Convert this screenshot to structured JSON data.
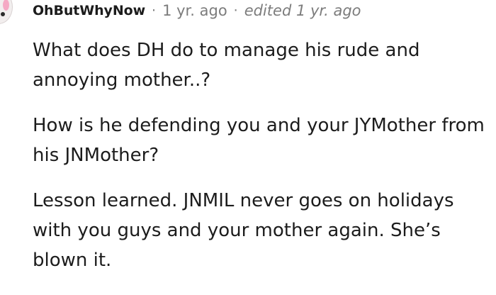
{
  "comment": {
    "author": "OhButWhyNow",
    "separator": "·",
    "timestamp": "1 yr. ago",
    "edited": "edited 1 yr. ago",
    "avatar_icon": "snoo-avatar-icon",
    "paragraphs": [
      "What does DH do to manage his rude and annoying mother..?",
      "How is he defending you and your JYMother from his JNMother?",
      "Lesson learned. JNMIL never goes on holidays with you guys and your mother again. She’s blown it."
    ]
  }
}
